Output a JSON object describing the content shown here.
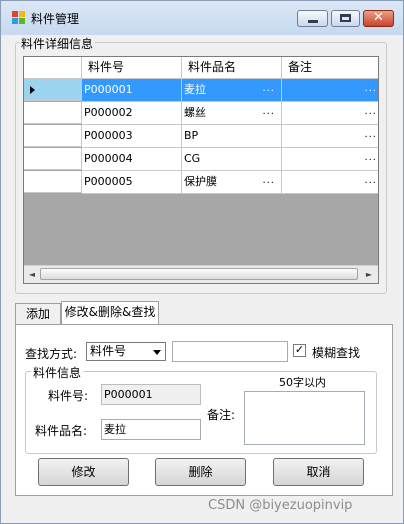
{
  "window": {
    "title": "料件管理"
  },
  "grid_group": {
    "title": "料件详细信息"
  },
  "grid": {
    "columns": [
      "料件号",
      "料件品名",
      "备注"
    ],
    "rows": [
      {
        "id": "P000001",
        "name": "麦拉",
        "name_more": "...",
        "note_more": "...",
        "selected": true
      },
      {
        "id": "P000002",
        "name": "螺丝",
        "name_more": "...",
        "note_more": "..."
      },
      {
        "id": "P000003",
        "name": "BP",
        "name_more": "",
        "note_more": "..."
      },
      {
        "id": "P000004",
        "name": "CG",
        "name_more": "",
        "note_more": "..."
      },
      {
        "id": "P000005",
        "name": "保护膜",
        "name_more": "...",
        "note_more": "..."
      }
    ],
    "scroll_left_icon": "◄",
    "scroll_right_icon": "►"
  },
  "tabs": [
    {
      "label": "添加",
      "active": false
    },
    {
      "label": "修改&删除&查找",
      "active": true
    }
  ],
  "search": {
    "label": "查找方式:",
    "field_value": "料件号",
    "input_value": "",
    "fuzzy_label": "模糊查找",
    "fuzzy_checked": true,
    "check_mark": "✓"
  },
  "info": {
    "title": "料件信息",
    "id_label": "料件号:",
    "id_value": "P000001",
    "name_label": "料件品名:",
    "name_value": "麦拉",
    "note_label": "备注:",
    "note_hint": "50字以内",
    "note_value": ""
  },
  "buttons": {
    "modify": "修改",
    "delete": "删除",
    "cancel": "取消"
  },
  "watermark": "CSDN @biyezuopinvip",
  "colors": {
    "selection": "#3399ff",
    "row_header_selected": "#9cd3ef",
    "grid_background": "#a7a7a7"
  }
}
